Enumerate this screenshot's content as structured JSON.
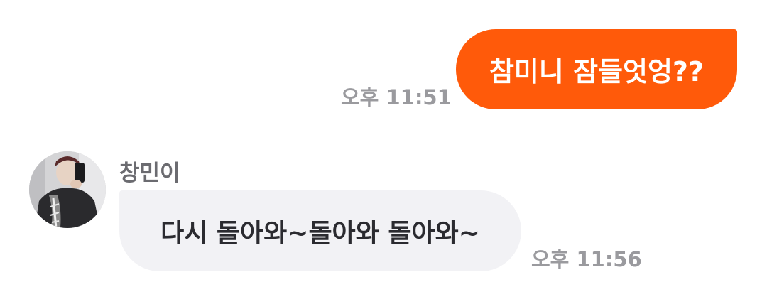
{
  "messages": {
    "outgoing": {
      "text": "참미니 잠들엇엉??",
      "time": "오후 11:51"
    },
    "incoming": {
      "sender": "창민이",
      "text": "다시 돌아와~돌아와 돌아와~",
      "time": "오후 11:56",
      "avatar_icon": "profile-photo"
    }
  },
  "colors": {
    "outgoing_bubble": "#FF5A0A",
    "incoming_bubble": "#F2F2F5",
    "timestamp": "#9A9A9E"
  }
}
